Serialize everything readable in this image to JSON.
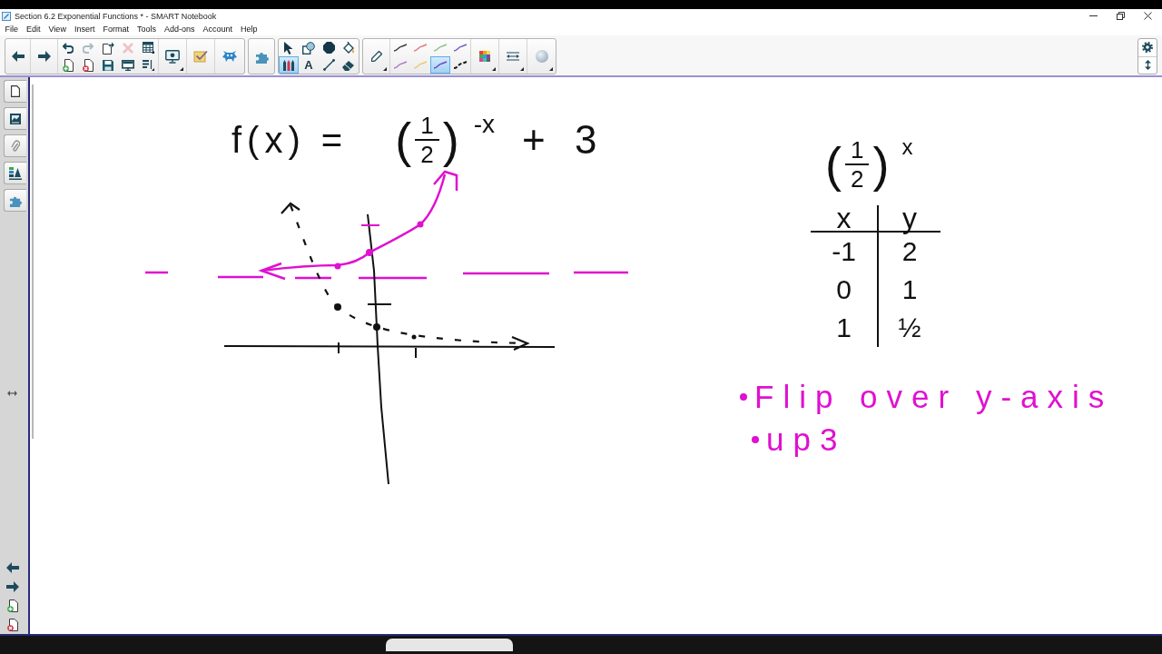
{
  "window": {
    "title": "Section 6.2 Exponential Functions * - SMART Notebook"
  },
  "menu": [
    "File",
    "Edit",
    "View",
    "Insert",
    "Format",
    "Tools",
    "Add-ons",
    "Account",
    "Help"
  ],
  "toolbar": {
    "page_actions": [
      {
        "kind": "undo",
        "disabled": false
      },
      {
        "kind": "add_page",
        "disabled": false
      },
      {
        "kind": "redo",
        "disabled": true
      },
      {
        "kind": "delete_page",
        "disabled": false
      },
      {
        "kind": "clone_page",
        "disabled": false
      },
      {
        "kind": "save",
        "disabled": false
      },
      {
        "kind": "delete",
        "disabled": true
      },
      {
        "kind": "screen_shade",
        "disabled": false
      },
      {
        "kind": "table",
        "disabled": false
      },
      {
        "kind": "text_style",
        "disabled": false
      }
    ],
    "draw_tools": [
      {
        "kind": "select",
        "selected": false
      },
      {
        "kind": "shape",
        "selected": false
      },
      {
        "kind": "polygon",
        "selected": false
      },
      {
        "kind": "fill",
        "selected": false
      },
      {
        "kind": "pens",
        "selected": true
      },
      {
        "kind": "text",
        "label": "A",
        "selected": false
      },
      {
        "kind": "line",
        "selected": false
      },
      {
        "kind": "eraser",
        "selected": false
      }
    ],
    "pen_styles": [
      {
        "kind": "solid",
        "color": "#3c3c3c",
        "selected": false
      },
      {
        "kind": "solid",
        "color": "#e07a7a",
        "selected": false
      },
      {
        "kind": "solid",
        "color": "#8cc08c",
        "selected": false
      },
      {
        "kind": "solid",
        "color": "#7a5cc8",
        "selected": false
      },
      {
        "kind": "solid",
        "color": "#b07ac8",
        "selected": false
      },
      {
        "kind": "solid",
        "color": "#ecc870",
        "selected": false
      },
      {
        "kind": "solid",
        "color": "#7040c8",
        "selected": true
      },
      {
        "kind": "dashed",
        "color": "#1a1a1a",
        "selected": false
      }
    ]
  },
  "canvas": {
    "equation": {
      "lhs": "f(x) =",
      "open": "(",
      "numerator": "1",
      "denominator": "2",
      "close": ")",
      "exponent": "-x",
      "rhs": "+ 3"
    },
    "parent_function": {
      "open": "(",
      "numerator": "1",
      "denominator": "2",
      "close": ")",
      "exponent": "x"
    },
    "table": {
      "headers": [
        "x",
        "y"
      ],
      "rows": [
        [
          "-1",
          "2"
        ],
        [
          "0",
          "1"
        ],
        [
          "1",
          "½"
        ]
      ]
    },
    "notes": [
      {
        "text": "Flip over y-axis"
      },
      {
        "text": "up3"
      }
    ]
  }
}
